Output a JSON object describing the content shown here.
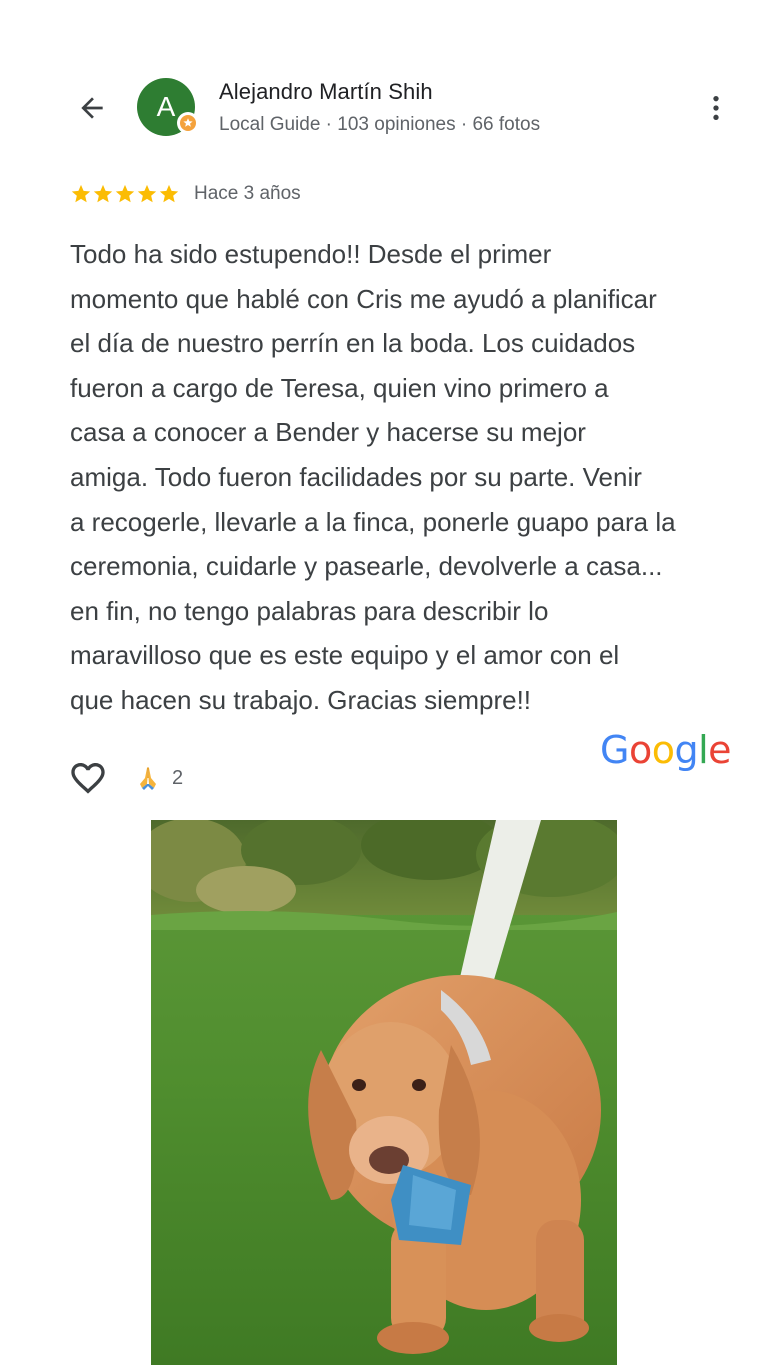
{
  "user": {
    "avatar_letter": "A",
    "name": "Alejandro Martín Shih",
    "meta": "Local Guide · 103 opiniones · 66 fotos"
  },
  "review": {
    "rating": 5,
    "rating_max": 5,
    "time_ago": "Hace 3 años",
    "text": "Todo ha sido estupendo!! Desde el primer\nmomento que hablé con Cris me ayudó a planificar\nel día de nuestro perrín en la boda. Los cuidados\nfueron a cargo de Teresa, quien vino primero a\ncasa a conocer a Bender y hacerse su mejor\namiga. Todo fueron facilidades por su parte. Venir\na recogerle, llevarle a la finca, ponerle guapo para la\nceremonia, cuidarle y pasearle, devolverle a casa...\nen fin, no tengo palabras para describir lo\nmaravilloso que es este equipo y el amor con el\nque hacen su trabajo. Gracias siempre!!"
  },
  "reactions": {
    "emoji": "🙏",
    "count": "2"
  },
  "logo": {
    "letters": [
      "G",
      "o",
      "o",
      "g",
      "l",
      "e"
    ]
  },
  "icons": {
    "back": "arrow-back-icon",
    "more": "more-vert-icon",
    "like": "heart-outline-icon",
    "badge": "local-guide-badge-icon",
    "star": "star-icon"
  },
  "colors": {
    "avatar": "#2e7d32",
    "star": "#fbbc04",
    "text_primary": "#202124",
    "text_secondary": "#5f6368",
    "text_body": "#3c4043",
    "google_blue": "#4285F4",
    "google_red": "#EA4335",
    "google_yellow": "#FBBC05",
    "google_green": "#34A853",
    "badge": "#f4a23c"
  }
}
